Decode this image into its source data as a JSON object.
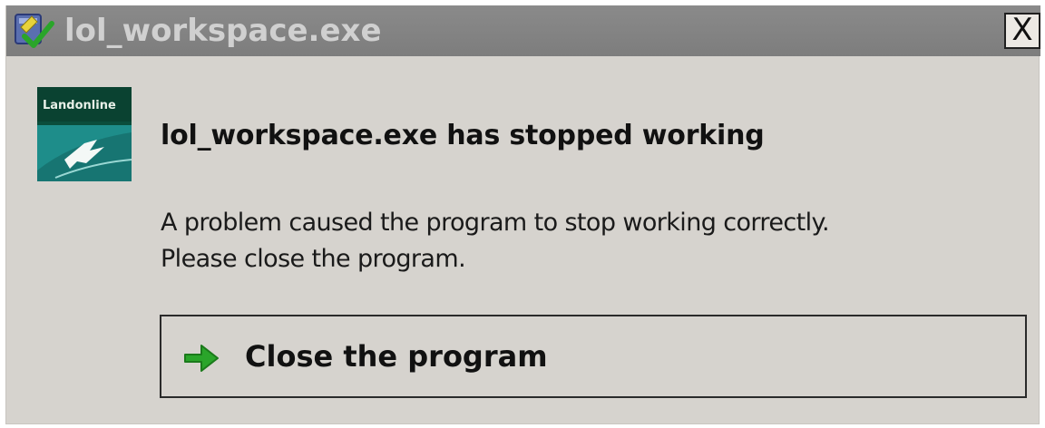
{
  "window": {
    "title": "lol_workspace.exe",
    "close_glyph": "X",
    "title_icon": "shield-check-icon"
  },
  "app": {
    "logo_text": "Landonline",
    "logo_icon": "landonline-logo-icon"
  },
  "dialog": {
    "heading": "lol_workspace.exe has stopped working",
    "message_line1": "A problem caused the program to stop working correctly.",
    "message_line2": "Please close the program.",
    "command_label": "Close the program",
    "command_icon": "green-arrow-right-icon"
  },
  "colors": {
    "titlebar": "#808080",
    "body": "#d6d3ce",
    "arrow_green": "#2aa52a",
    "logo_dark": "#0a4a3a",
    "logo_teal": "#1f8f8a"
  }
}
